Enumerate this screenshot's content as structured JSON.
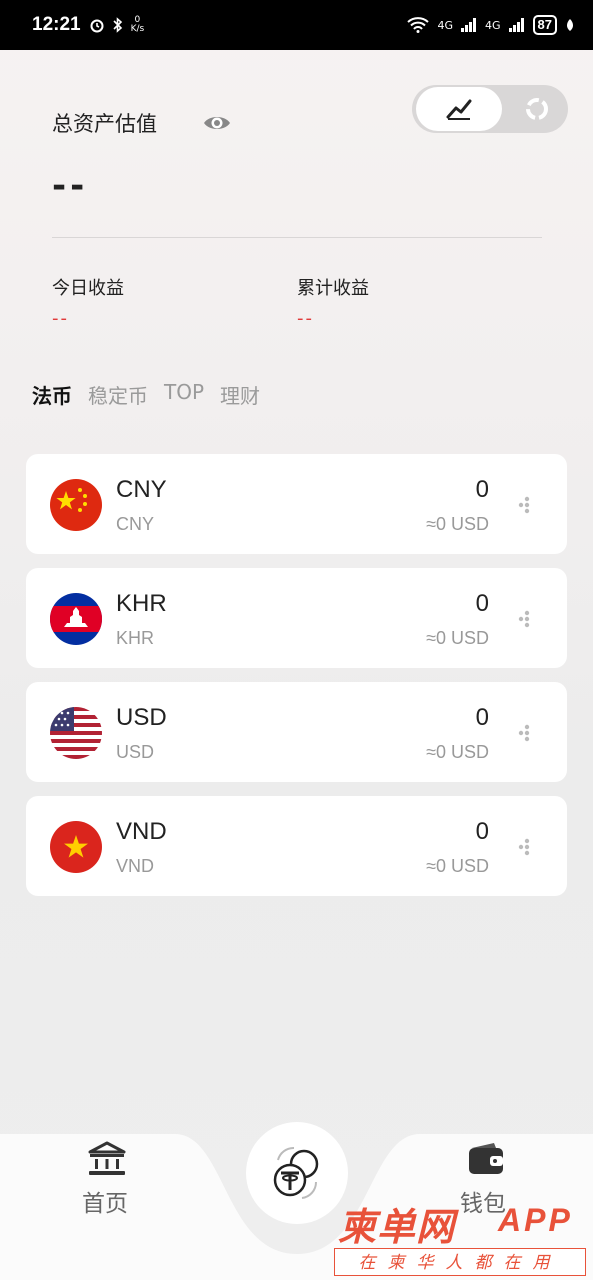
{
  "status_bar": {
    "time": "12:21",
    "speed_value": "0",
    "speed_unit": "K/s",
    "net_a": "4G",
    "net_b": "4G",
    "battery": "87"
  },
  "header": {
    "title": "总资产估值",
    "total_value": "--",
    "toggle_active_icon": "chart-icon",
    "toggle_inactive_icon": "refresh-icon"
  },
  "stats": {
    "today": {
      "label": "今日收益",
      "value": "--"
    },
    "cumulative": {
      "label": "累计收益",
      "value": "--"
    }
  },
  "tabs": [
    "法币",
    "稳定币",
    "TOP",
    "理财"
  ],
  "currencies": [
    {
      "code": "CNY",
      "sub": "CNY",
      "amount": "0",
      "usd": "≈0 USD",
      "flag": "china-flag-icon"
    },
    {
      "code": "KHR",
      "sub": "KHR",
      "amount": "0",
      "usd": "≈0 USD",
      "flag": "cambodia-flag-icon"
    },
    {
      "code": "USD",
      "sub": "USD",
      "amount": "0",
      "usd": "≈0 USD",
      "flag": "usa-flag-icon"
    },
    {
      "code": "VND",
      "sub": "VND",
      "amount": "0",
      "usd": "≈0 USD",
      "flag": "vietnam-flag-icon"
    }
  ],
  "nav": {
    "home": "首页",
    "wallet": "钱包",
    "center_icon": "tether-exchange-icon"
  },
  "watermark": {
    "main": "柬单网",
    "app": "APP",
    "sub": "在柬华人都在用"
  },
  "colors": {
    "accent_red": "#e03a3a",
    "watermark": "#e8523a"
  }
}
